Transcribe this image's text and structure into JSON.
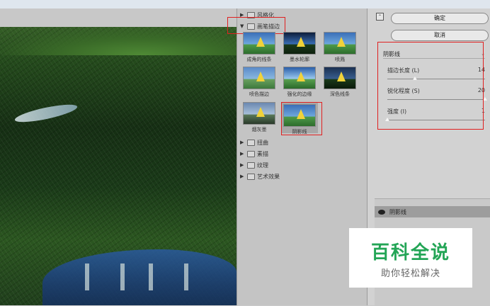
{
  "gallery": {
    "categories_top": [
      {
        "label": "风格化",
        "expanded": false
      },
      {
        "label": "画笔描边",
        "expanded": true
      }
    ],
    "thumbnails": [
      {
        "label": "成角的线条"
      },
      {
        "label": "墨水轮廓"
      },
      {
        "label": "喷溅"
      },
      {
        "label": "喷色描边"
      },
      {
        "label": "强化的边缘"
      },
      {
        "label": "深色线条"
      },
      {
        "label": "烟灰墨"
      },
      {
        "label": "阴影线",
        "selected": true
      }
    ],
    "categories_bottom": [
      {
        "label": "扭曲",
        "expanded": false
      },
      {
        "label": "素描",
        "expanded": false
      },
      {
        "label": "纹理",
        "expanded": false
      },
      {
        "label": "艺术效果",
        "expanded": false
      }
    ]
  },
  "settings": {
    "ok_label": "确定",
    "cancel_label": "取消",
    "filter_select": "阴影线",
    "params": [
      {
        "label": "描边长度 (L)",
        "value": "14",
        "fraction": 0.28
      },
      {
        "label": "锐化程度 (S)",
        "value": "20",
        "fraction": 1.0
      },
      {
        "label": "强度 (I)",
        "value": "1",
        "fraction": 0.0
      }
    ],
    "layer_name": "阴影线"
  },
  "watermark": {
    "line1": "百科全说",
    "line2": "助你轻松解决"
  },
  "colors": {
    "accent_red": "#e02020",
    "watermark_green": "#23a556"
  }
}
